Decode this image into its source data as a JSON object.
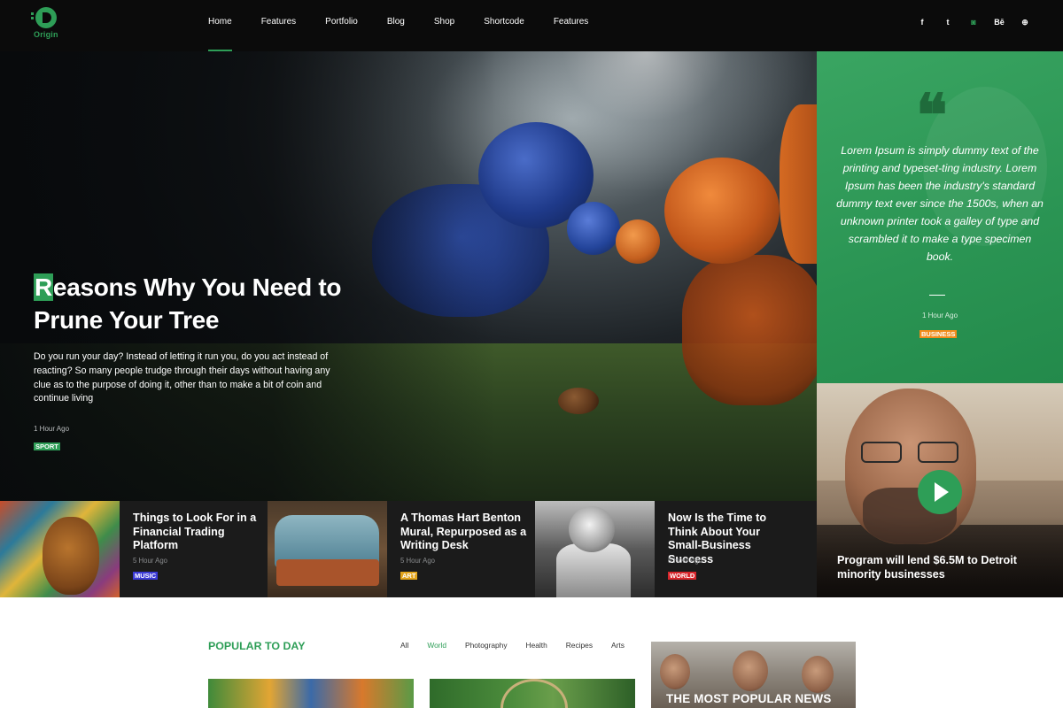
{
  "header": {
    "logo_text": "Origin",
    "nav": [
      {
        "label": "Home",
        "active": true
      },
      {
        "label": "Features"
      },
      {
        "label": "Portfolio"
      },
      {
        "label": "Blog"
      },
      {
        "label": "Shop"
      },
      {
        "label": "Shortcode"
      },
      {
        "label": "Features"
      }
    ],
    "social": [
      {
        "icon": "facebook-icon",
        "glyph": "f"
      },
      {
        "icon": "twitter-icon",
        "glyph": "t"
      },
      {
        "icon": "instagram-icon",
        "glyph": "◙"
      },
      {
        "icon": "behance-icon",
        "glyph": "Bē"
      },
      {
        "icon": "dribbble-icon",
        "glyph": "⊕"
      }
    ]
  },
  "hero": {
    "title_first_letter": "R",
    "title_rest": "easons Why You Need to Prune Your Tree",
    "description": "Do you run your day? Instead of letting it run you, do you act instead of reacting? So many people trudge through their days without having any clue as to the purpose of doing it, other than to make a bit of coin and continue living",
    "time": "1 Hour Ago",
    "tag": "SPORT"
  },
  "quote": {
    "mark": "❝",
    "text": "Lorem Ipsum is simply dummy text of the printing and typeset-ting industry. Lorem Ipsum has been the industry's standard dummy text ever since the 1500s, when an unknown printer took a galley of type and scrambled it to make a type specimen book.",
    "time": "1 Hour Ago",
    "tag": "BUSINESS"
  },
  "video": {
    "title": "Program will lend $6.5M to Detroit minority businesses"
  },
  "cards": [
    {
      "title": "Things to Look For in a Financial Trading Platform",
      "time": "5 Hour Ago",
      "tag": "MUSIC",
      "tag_color": "#3b3ad6"
    },
    {
      "title": "A Thomas Hart Benton Mural, Repurposed as a Writing Desk",
      "time": "5 Hour Ago",
      "tag": "ART",
      "tag_color": "#e2a41b"
    },
    {
      "title": "Now Is the Time to Think About Your Small-Business Success",
      "time": "5 Hour Ago",
      "tag": "WORLD",
      "tag_color": "#d8262c"
    }
  ],
  "popular": {
    "title": "POPULAR TO DAY",
    "filters": [
      {
        "label": "All"
      },
      {
        "label": "World",
        "active": true
      },
      {
        "label": "Photography"
      },
      {
        "label": "Health"
      },
      {
        "label": "Recipes"
      },
      {
        "label": "Arts"
      }
    ]
  },
  "news_box": {
    "title": "THE MOST POPULAR NEWS"
  },
  "colors": {
    "accent": "#2e9e57",
    "business": "#f28c1b"
  }
}
